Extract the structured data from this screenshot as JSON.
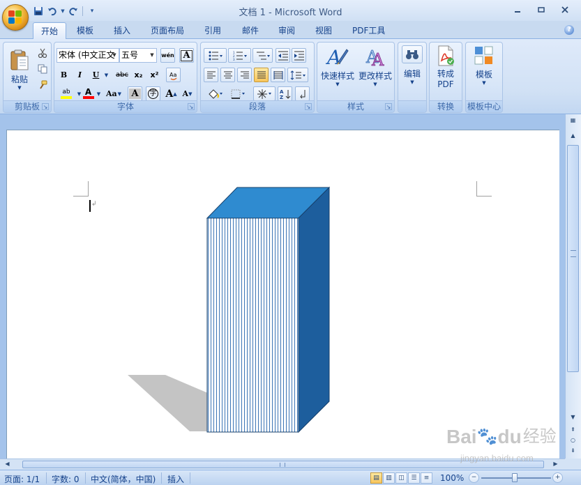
{
  "window": {
    "title": "文档 1 - Microsoft Word",
    "minimize_icon": "minimize-icon",
    "maximize_icon": "maximize-icon",
    "close_icon": "close-icon"
  },
  "tabs": [
    "开始",
    "模板",
    "插入",
    "页面布局",
    "引用",
    "邮件",
    "审阅",
    "视图",
    "PDF工具"
  ],
  "active_tab": "开始",
  "ribbon": {
    "clipboard": {
      "label": "剪贴板",
      "paste": "粘贴"
    },
    "font": {
      "label": "字体",
      "font_name": "宋体 (中文正文",
      "font_size": "五号",
      "bold": "B",
      "italic": "I",
      "underline": "U",
      "strike": "abc",
      "subscript": "x₂",
      "superscript": "x²",
      "change_case": "Aa",
      "char_shade": "A",
      "enclose": "字",
      "grow": "A",
      "shrink": "A",
      "font_color": "A",
      "highlight": "ab",
      "phonetic": "wén",
      "char_border": "A",
      "clear": "A"
    },
    "paragraph": {
      "label": "段落"
    },
    "styles": {
      "label": "样式",
      "quick_styles": "快速样式",
      "change_styles": "更改样式"
    },
    "editing": {
      "label": "编辑"
    },
    "convert": {
      "label": "转换",
      "to_pdf_1": "转成",
      "to_pdf_2": "PDF"
    },
    "template_center": {
      "label": "模板中心",
      "template": "模板"
    }
  },
  "document": {
    "shape_front_color": "#ffffff",
    "shape_top_color": "#2f8bd0",
    "shape_side_color": "#1d5e9d",
    "shape_stripe_color": "#3b74b5",
    "shadow_color": "#c4c4c4"
  },
  "status": {
    "page": "页面: 1/1",
    "words": "字数: 0",
    "language": "中文(简体，中国)",
    "mode": "插入",
    "zoom": "100%"
  },
  "watermark": {
    "brand": "Bai",
    "brand2": "du",
    "suffix": "经验",
    "url": "jingyan.baidu.com"
  }
}
